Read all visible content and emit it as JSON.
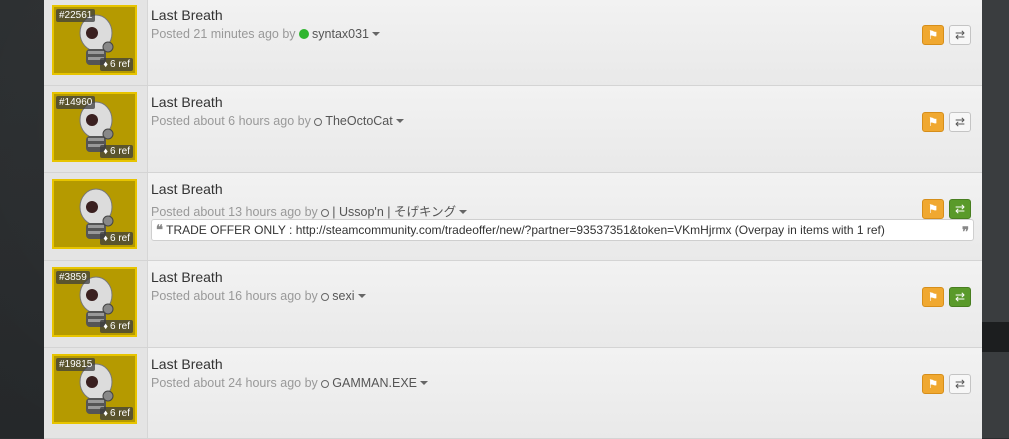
{
  "listings": [
    {
      "id": "#22561",
      "ref": "6 ref",
      "title": "Last Breath",
      "posted": "Posted 21 minutes ago by",
      "user": "syntax031",
      "online": true,
      "trade_active": false,
      "comment": null
    },
    {
      "id": "#14960",
      "ref": "6 ref",
      "title": "Last Breath",
      "posted": "Posted about 6 hours ago by",
      "user": "TheOctoCat",
      "online": false,
      "trade_active": false,
      "comment": null
    },
    {
      "id": "",
      "ref": "6 ref",
      "title": "Last Breath",
      "posted": "Posted about 13 hours ago by",
      "user": "| Ussop'n | そげキング",
      "online": false,
      "trade_active": true,
      "comment": "TRADE OFFER ONLY : http://steamcommunity.com/tradeoffer/new/?partner=93537351&token=VKmHjrmx (Overpay in items with 1 ref)"
    },
    {
      "id": "#3859",
      "ref": "6 ref",
      "title": "Last Breath",
      "posted": "Posted about 16 hours ago by",
      "user": "sexi",
      "online": false,
      "trade_active": true,
      "comment": null
    },
    {
      "id": "#19815",
      "ref": "6 ref",
      "title": "Last Breath",
      "posted": "Posted about 24 hours ago by",
      "user": "GAMMAN.EXE",
      "online": false,
      "trade_active": false,
      "comment": null
    }
  ],
  "icons": {
    "flag": "flag-icon",
    "trade": "exchange-icon",
    "tag": "tag-icon",
    "quote": "quote-icon"
  },
  "colors": {
    "accent_orange": "#f0a830",
    "trade_green": "#5a9a2a",
    "online_green": "#2fb52f",
    "item_bg": "#b59a00"
  }
}
